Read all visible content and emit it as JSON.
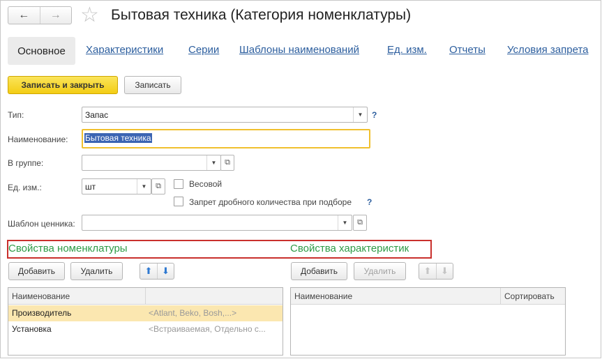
{
  "window": {
    "title": "Бытовая техника (Категория номенклатуры)",
    "back_icon": "←",
    "forward_icon": "→",
    "star_icon": "☆"
  },
  "tabs": [
    {
      "label": "Основное",
      "active": true
    },
    {
      "label": "Характеристики"
    },
    {
      "label": "Серии"
    },
    {
      "label": "Шаблоны наименований"
    },
    {
      "label": "Ед. изм."
    },
    {
      "label": "Отчеты"
    },
    {
      "label": "Условия запрета"
    }
  ],
  "toolbar": {
    "save_close_label": "Записать и закрыть",
    "save_label": "Записать"
  },
  "form": {
    "type_label": "Тип:",
    "type_value": "Запас",
    "name_label": "Наименование:",
    "name_value": "Бытовая техника",
    "group_label": "В группе:",
    "group_value": "",
    "unit_label": "Ед. изм.:",
    "unit_value": "шт",
    "weight_label": "Весовой",
    "weight_checked": false,
    "fraction_label": "Запрет дробного количества при подборе",
    "fraction_checked": false,
    "price_template_label": "Шаблон ценника:",
    "price_template_value": "",
    "help_mark": "?"
  },
  "properties_left": {
    "title": "Свойства номенклатуры",
    "add_label": "Добавить",
    "delete_label": "Удалить",
    "table": {
      "columns": [
        "Наименование",
        ""
      ],
      "rows": [
        {
          "name": "Производитель",
          "values": "<Atlant, Beko, Bosh,...>",
          "selected": true
        },
        {
          "name": "Установка",
          "values": "<Встраиваемая, Отдельно с...",
          "selected": false
        }
      ]
    }
  },
  "properties_right": {
    "title": "Свойства характеристик",
    "add_label": "Добавить",
    "delete_label": "Удалить",
    "table": {
      "columns": [
        "Наименование",
        "Сортировать"
      ],
      "rows": []
    }
  },
  "colors": {
    "accent_yellow": "#f3cd14",
    "link_blue": "#2c5e9e",
    "section_green": "#2e9b46",
    "highlight_red": "#c9302c",
    "selected_row": "#fbe7b0"
  }
}
